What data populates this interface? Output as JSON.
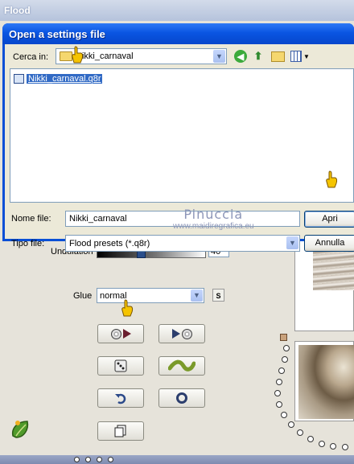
{
  "background_window": {
    "title": "Flood",
    "undulation_label": "Undulation",
    "undulation_value": "40",
    "undulation_level": 0.4,
    "glue_label": "Glue",
    "glue_value": "normal",
    "s_button_label": "S"
  },
  "dialog": {
    "title": "Open a settings file",
    "look_in_label": "Cerca in:",
    "look_in_value": "Nikki_carnaval",
    "files": [
      {
        "name": "Nikki_carnaval.q8r"
      }
    ],
    "file_name_label": "Nome file:",
    "file_name_value": "Nikki_carnaval",
    "file_type_label": "Tipo file:",
    "file_type_value": "Flood presets (*.q8r)",
    "open_button": "Apri",
    "cancel_button": "Annulla"
  },
  "watermark": {
    "line1": "Pinuccia",
    "line2": "www.maidiregrafica.eu"
  },
  "colors": {
    "dialog_title_bar": "#0a55e2",
    "selection": "#316ac5",
    "pointer_hand": "#f5c400"
  },
  "icons": [
    "folder-icon",
    "back-icon",
    "up-folder-icon",
    "new-folder-icon",
    "view-menu-icon",
    "file-icon",
    "disc-icon",
    "play-icon",
    "dice-icon",
    "wave-icon",
    "undo-icon",
    "circle-icon",
    "copy-icon",
    "pointing-hand-icon",
    "leaf-logo-icon"
  ]
}
